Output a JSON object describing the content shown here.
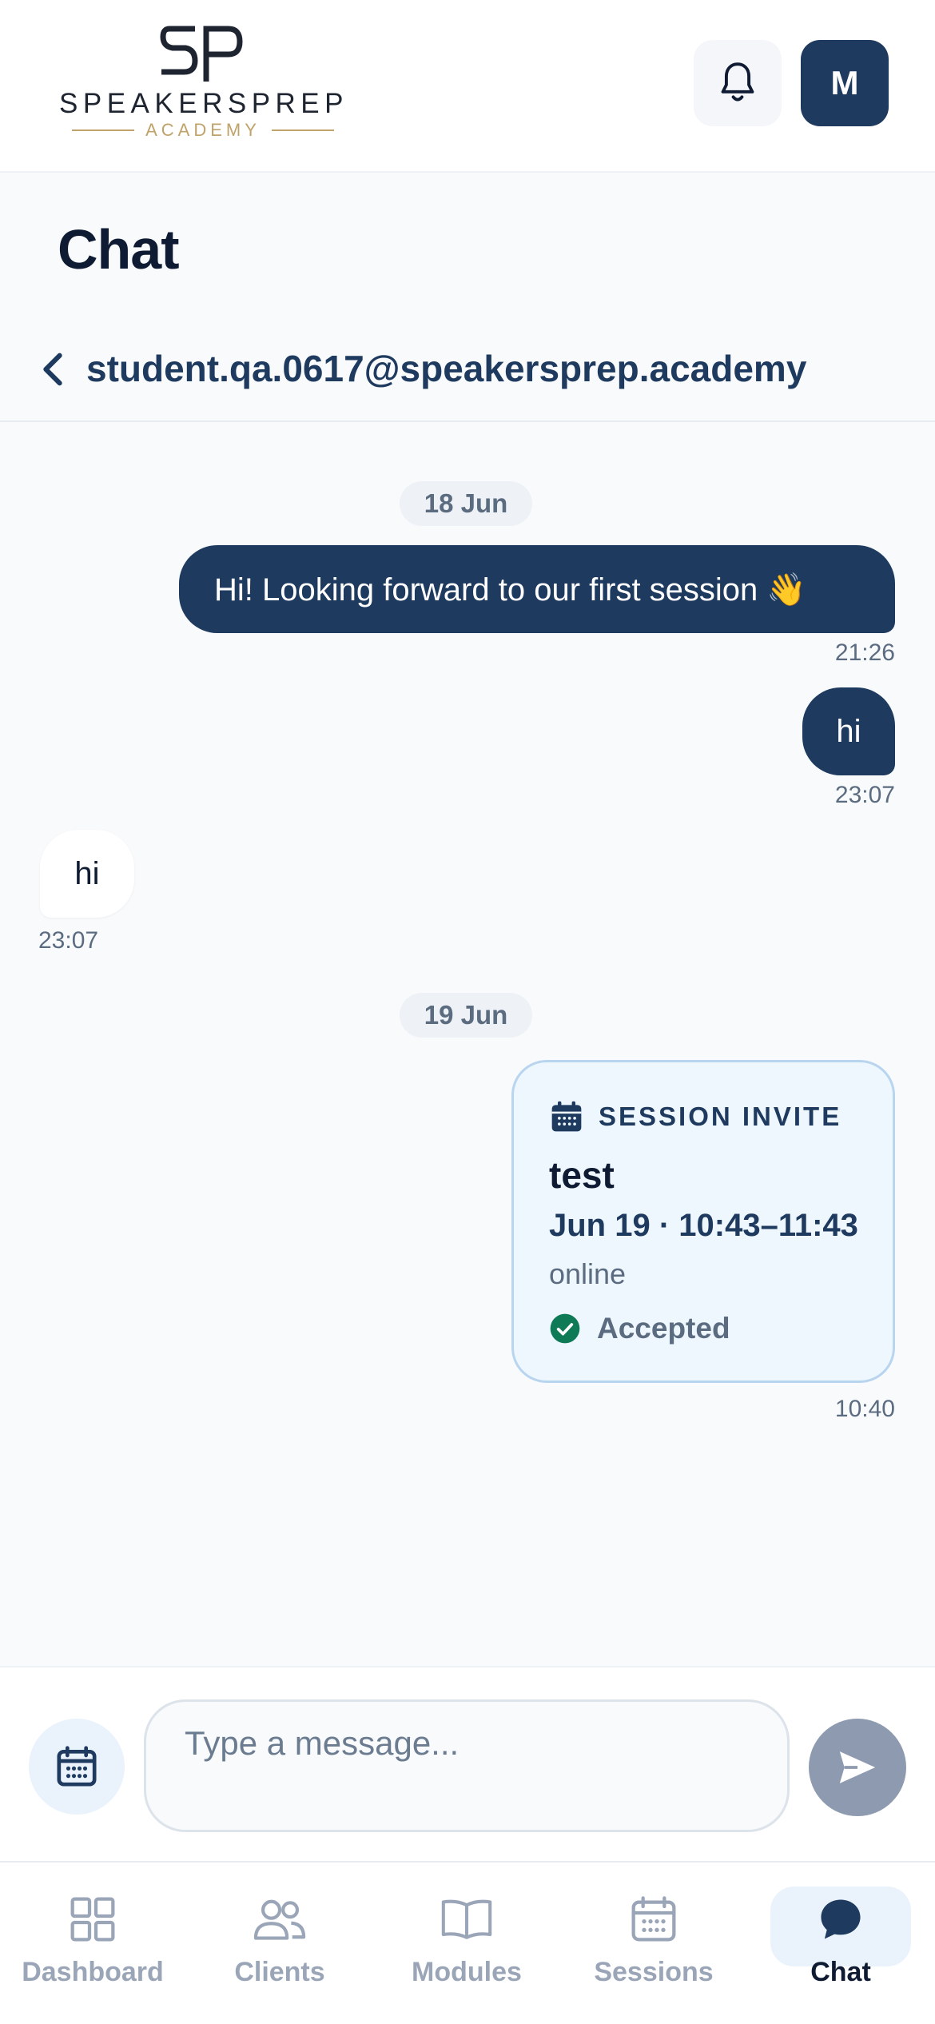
{
  "header": {
    "logo_word": "SPEAKERSPREP",
    "logo_sub": "ACADEMY",
    "avatar_initial": "M",
    "icons": [
      "bell-icon"
    ]
  },
  "page": {
    "title": "Chat"
  },
  "conversation": {
    "title": "student.qa.0617@speakersprep.academy"
  },
  "messages": {
    "date1": "18 Jun",
    "m1_text": "Hi! Looking forward to our first session 👋",
    "m1_time": "21:26",
    "m2_text": "hi",
    "m2_time": "23:07",
    "m3_text": "hi",
    "m3_time": "23:07",
    "date2": "19 Jun",
    "invite": {
      "label": "SESSION INVITE",
      "title": "test",
      "when": "Jun 19 · 10:43–11:43",
      "where": "online",
      "status": "Accepted",
      "time": "10:40"
    }
  },
  "composer": {
    "placeholder": "Type a message..."
  },
  "nav": {
    "items": [
      {
        "label": "Dashboard",
        "icon": "grid-icon"
      },
      {
        "label": "Clients",
        "icon": "users-icon"
      },
      {
        "label": "Modules",
        "icon": "book-icon"
      },
      {
        "label": "Sessions",
        "icon": "calendar-icon"
      },
      {
        "label": "Chat",
        "icon": "chat-bubble-icon"
      }
    ],
    "active": "Chat"
  },
  "colors": {
    "brand_navy": "#1e3a5f",
    "gold": "#bfa36a",
    "accepted_green": "#0f7a56",
    "send_disabled": "#8e9ab0"
  }
}
